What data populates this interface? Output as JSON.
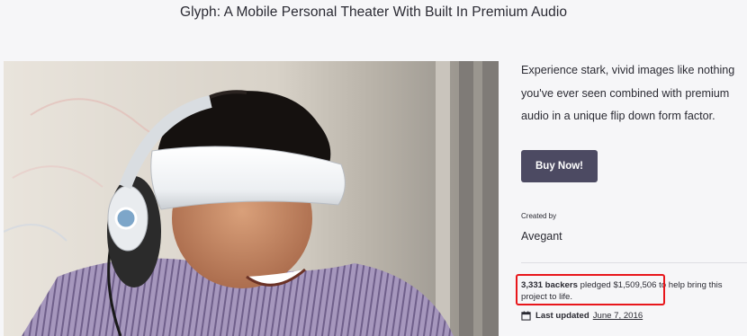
{
  "page": {
    "title": "Glyph: A Mobile Personal Theater With Built In Premium Audio"
  },
  "project": {
    "description": "Experience stark, vivid images like nothing you've ever seen combined with premium audio in a unique flip down form factor.",
    "buy_label": "Buy Now!",
    "created_by_label": "Created by",
    "creator": "Avegant",
    "backers": "3,331 backers",
    "pledged_prefix": " pledged ",
    "pledged_amount": "$1,509,506",
    "pledged_suffix": " to help bring this project to life.",
    "last_updated_label": "Last updated",
    "last_updated_date": "June 7, 2016"
  },
  "colors": {
    "button_bg": "#4c4a62",
    "highlight": "#e8161b",
    "background": "#f6f6f8"
  },
  "icons": {
    "calendar": "calendar-icon"
  }
}
